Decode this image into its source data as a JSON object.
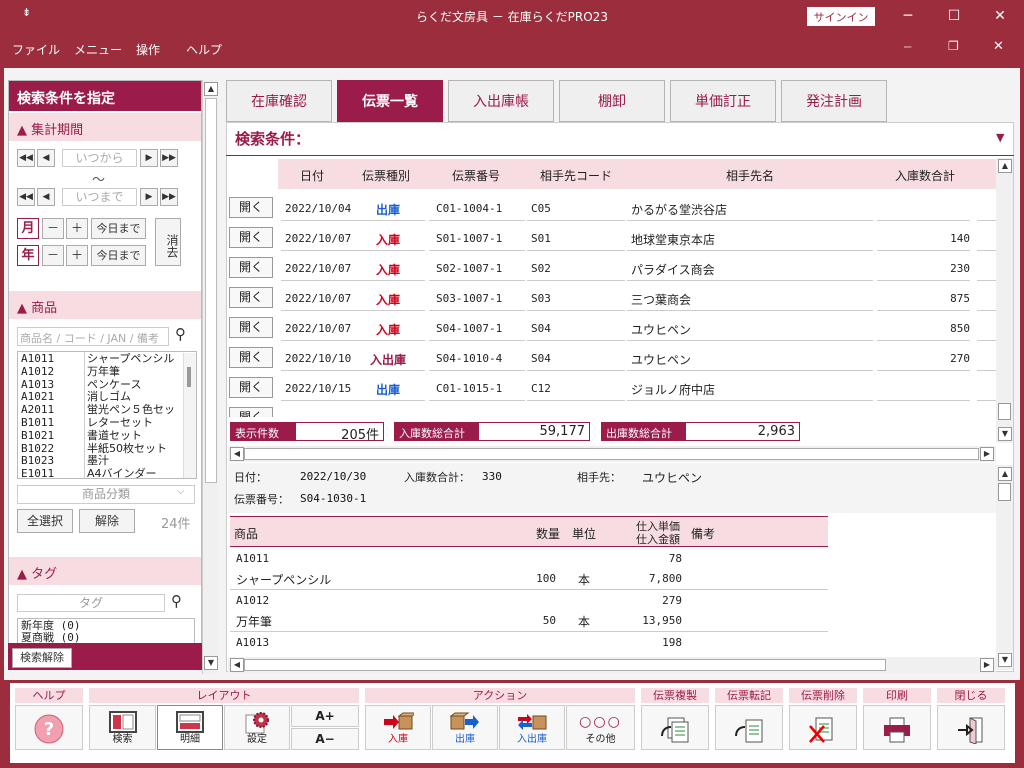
{
  "window": {
    "title": "らくだ文房具 － 在庫らくだPRO23",
    "signin": "サインイン"
  },
  "menubar": {
    "items": [
      "ファイル",
      "メニュー",
      "操作",
      "ヘルプ"
    ]
  },
  "left": {
    "header": "検索条件を指定",
    "period": {
      "title": "集計期間",
      "from_placeholder": "いつから",
      "tilde": "～",
      "to_placeholder": "いつまで",
      "month": "月",
      "year": "年",
      "minus": "－",
      "plus": "＋",
      "today": "今日まで",
      "clear": "消去"
    },
    "product": {
      "title": "商品",
      "search_placeholder": "商品名 / コード / JAN / 備考",
      "items": [
        {
          "code": "A1011",
          "name": "シャープペンシル"
        },
        {
          "code": "A1012",
          "name": "万年筆"
        },
        {
          "code": "A1013",
          "name": "ペンケース"
        },
        {
          "code": "A1021",
          "name": "消しゴム"
        },
        {
          "code": "A2011",
          "name": "蛍光ペン５色セッ"
        },
        {
          "code": "B1011",
          "name": "レターセット"
        },
        {
          "code": "B1021",
          "name": "書道セット"
        },
        {
          "code": "B1022",
          "name": "半紙50枚セット"
        },
        {
          "code": "B1023",
          "name": "墨汁"
        },
        {
          "code": "E1011",
          "name": "A4バインダー"
        }
      ],
      "category_placeholder": "商品分類",
      "select_all": "全選択",
      "release": "解除",
      "count": "24件"
    },
    "tag": {
      "title": "タグ",
      "placeholder": "タグ",
      "items": [
        "新年度 (0)",
        "夏商戦 (0)"
      ]
    },
    "reset": "検索解除"
  },
  "tabs": [
    "在庫確認",
    "伝票一覧",
    "入出庫帳",
    "棚卸",
    "単価訂正",
    "発注計画"
  ],
  "search_title": "検索条件：",
  "table": {
    "headers": [
      "日付",
      "伝票種別",
      "伝票番号",
      "相手先コード",
      "相手先名",
      "入庫数合計"
    ],
    "open_label": "開く",
    "rows": [
      {
        "date": "2022/10/04",
        "type": "出庫",
        "no": "C01-1004-1",
        "code": "C05",
        "name": "かるがる堂渋谷店",
        "qty": ""
      },
      {
        "date": "2022/10/07",
        "type": "入庫",
        "no": "S01-1007-1",
        "code": "S01",
        "name": "地球堂東京本店",
        "qty": "140"
      },
      {
        "date": "2022/10/07",
        "type": "入庫",
        "no": "S02-1007-1",
        "code": "S02",
        "name": "パラダイス商会",
        "qty": "230"
      },
      {
        "date": "2022/10/07",
        "type": "入庫",
        "no": "S03-1007-1",
        "code": "S03",
        "name": "三つ葉商会",
        "qty": "875"
      },
      {
        "date": "2022/10/07",
        "type": "入庫",
        "no": "S04-1007-1",
        "code": "S04",
        "name": "ユウヒペン",
        "qty": "850"
      },
      {
        "date": "2022/10/10",
        "type": "入出庫",
        "no": "S04-1010-4",
        "code": "S04",
        "name": "ユウヒペン",
        "qty": "270"
      },
      {
        "date": "2022/10/15",
        "type": "出庫",
        "no": "C01-1015-1",
        "code": "C12",
        "name": "ジョルノ府中店",
        "qty": ""
      }
    ]
  },
  "summary": {
    "count_label": "表示件数",
    "count_value": "205件",
    "in_label": "入庫数総合計",
    "in_value": "59,177",
    "out_label": "出庫数総合計",
    "out_value": "2,963"
  },
  "detail": {
    "date_label": "日付：",
    "date": "2022/10/30",
    "total_label": "入庫数合計：",
    "total": "330",
    "partner_label": "相手先：",
    "partner": "ユウヒペン",
    "slip_label": "伝票番号：",
    "slip": "S04-1030-1",
    "headers": {
      "product": "商品",
      "qty": "数量",
      "unit": "単位",
      "price1": "仕入単価",
      "price2": "仕入金額",
      "note": "備考"
    },
    "lines": [
      {
        "code": "A1011",
        "name": "シャープペンシル",
        "qty": "100",
        "unit": "本",
        "price": "78",
        "amount": "7,800"
      },
      {
        "code": "A1012",
        "name": "万年筆",
        "qty": "50",
        "unit": "本",
        "price": "279",
        "amount": "13,950"
      },
      {
        "code": "A1013",
        "name": "",
        "qty": "",
        "unit": "",
        "price": "198",
        "amount": ""
      }
    ]
  },
  "toolbar": {
    "groups": [
      "ヘルプ",
      "レイアウト",
      "アクション",
      "伝票複製",
      "伝票転記",
      "伝票削除",
      "印刷",
      "閉じる"
    ],
    "layout": [
      "検索",
      "明細",
      "設定"
    ],
    "font_up": "A+",
    "font_down": "A−",
    "actions": [
      "入庫",
      "出庫",
      "入出庫",
      "その他"
    ]
  },
  "colors": {
    "accent": "#9b1b4b",
    "title": "#9b2d3d",
    "in": "#d0021b",
    "out": "#1a5fd1"
  }
}
